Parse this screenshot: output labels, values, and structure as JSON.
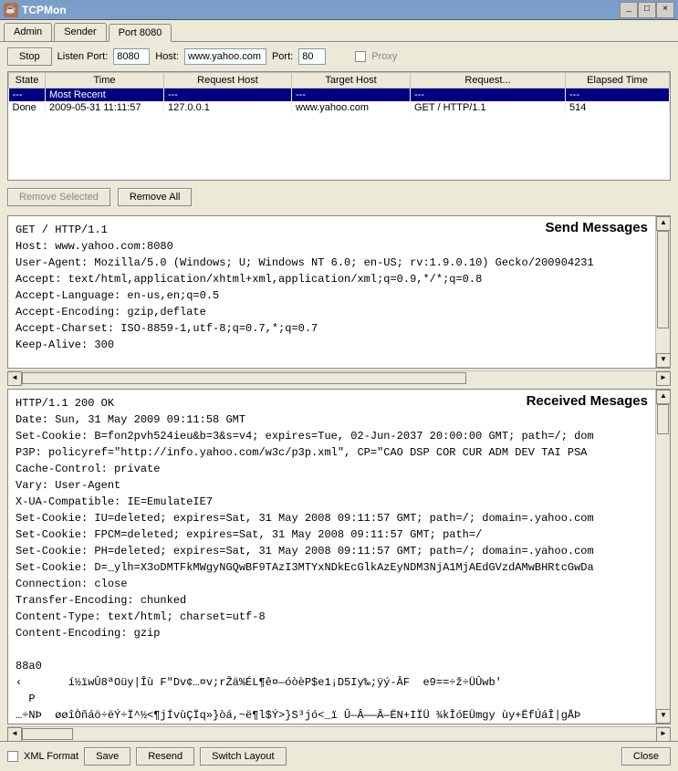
{
  "window": {
    "title": "TCPMon"
  },
  "tabs": [
    "Admin",
    "Sender",
    "Port 8080"
  ],
  "active_tab": 2,
  "toolbar": {
    "stop_label": "Stop",
    "listen_port_label": "Listen Port:",
    "listen_port_value": "8080",
    "host_label": "Host:",
    "host_value": "www.yahoo.com",
    "port_label": "Port:",
    "port_value": "80",
    "proxy_label": "Proxy"
  },
  "table": {
    "columns": [
      "State",
      "Time",
      "Request Host",
      "Target Host",
      "Request...",
      "Elapsed Time"
    ],
    "rows": [
      {
        "state": "---",
        "time": "Most Recent",
        "req_host": "---",
        "tgt_host": "---",
        "request": "---",
        "elapsed": "---",
        "selected": true
      },
      {
        "state": "Done",
        "time": "2009-05-31 11:11:57",
        "req_host": "127.0.0.1",
        "tgt_host": "www.yahoo.com",
        "request": "GET / HTTP/1.1",
        "elapsed": "514",
        "selected": false
      }
    ]
  },
  "mid_buttons": {
    "remove_selected": "Remove Selected",
    "remove_all": "Remove All"
  },
  "send_panel": {
    "title": "Send Messages",
    "content": "GET / HTTP/1.1\nHost: www.yahoo.com:8080\nUser-Agent: Mozilla/5.0 (Windows; U; Windows NT 6.0; en-US; rv:1.9.0.10) Gecko/200904231\nAccept: text/html,application/xhtml+xml,application/xml;q=0.9,*/*;q=0.8\nAccept-Language: en-us,en;q=0.5\nAccept-Encoding: gzip,deflate\nAccept-Charset: ISO-8859-1,utf-8;q=0.7,*;q=0.7\nKeep-Alive: 300"
  },
  "recv_panel": {
    "title": "Received Mesages",
    "content": "HTTP/1.1 200 OK\nDate: Sun, 31 May 2009 09:11:58 GMT\nSet-Cookie: B=fon2pvh524ieu&b=3&s=v4; expires=Tue, 02-Jun-2037 20:00:00 GMT; path=/; dom\nP3P: policyref=\"http://info.yahoo.com/w3c/p3p.xml\", CP=\"CAO DSP COR CUR ADM DEV TAI PSA\nCache-Control: private\nVary: User-Agent\nX-UA-Compatible: IE=EmulateIE7\nSet-Cookie: IU=deleted; expires=Sat, 31 May 2008 09:11:57 GMT; path=/; domain=.yahoo.com\nSet-Cookie: FPCM=deleted; expires=Sat, 31 May 2008 09:11:57 GMT; path=/\nSet-Cookie: PH=deleted; expires=Sat, 31 May 2008 09:11:57 GMT; path=/; domain=.yahoo.com\nSet-Cookie: D=_ylh=X3oDMTFkMWgyNGQwBF9TAzI3MTYxNDkEcGlkAzEyNDM3NjA1MjAEdGVzdAMwBHRtcGwDa\nConnection: close\nTransfer-Encoding: chunked\nContent-Type: text/html; charset=utf-8\nContent-Encoding: gzip\n\n88a0\n‹       í½ïwÛ8ªOüy|Îù FʺDv¢…¤v;rŽä%ÉL¶ê¤—óòèP$e1¡D5Iy‰;ÿý-ÂF  e9==÷ž÷ÜÛwb'\n  P\n…÷NÞ  øøîÒñáö÷ëÝ÷Ï^½<¶jÍvùÇÏq»}òá,~ë¶l$Ý>}S³jó<_ï Û—Â——Â—ËN+IÏÜ ¾kÎóEÜmgy ùy+ËfÚáÎ|gÅÞ"
  },
  "bottom": {
    "xml_format": "XML Format",
    "save": "Save",
    "resend": "Resend",
    "switch_layout": "Switch Layout",
    "close": "Close"
  }
}
